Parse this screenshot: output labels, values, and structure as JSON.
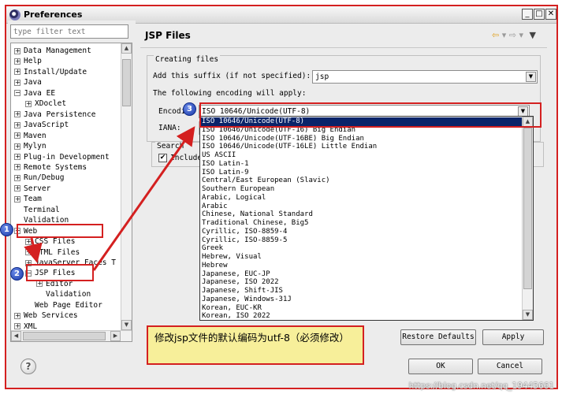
{
  "window": {
    "title": "Preferences",
    "minimize": "_",
    "maximize": "□",
    "close": "✕"
  },
  "sidebar": {
    "filter_placeholder": "type filter text",
    "tree": [
      {
        "label": "Data Management",
        "toggle": "+"
      },
      {
        "label": "Help",
        "toggle": "+"
      },
      {
        "label": "Install/Update",
        "toggle": "+"
      },
      {
        "label": "Java",
        "toggle": "+"
      },
      {
        "label": "Java EE",
        "toggle": "−"
      },
      {
        "label": "XDoclet",
        "toggle": "+"
      },
      {
        "label": "Java Persistence",
        "toggle": "+"
      },
      {
        "label": "JavaScript",
        "toggle": "+"
      },
      {
        "label": "Maven",
        "toggle": "+"
      },
      {
        "label": "Mylyn",
        "toggle": "+"
      },
      {
        "label": "Plug-in Development",
        "toggle": "+"
      },
      {
        "label": "Remote Systems",
        "toggle": "+"
      },
      {
        "label": "Run/Debug",
        "toggle": "+"
      },
      {
        "label": "Server",
        "toggle": "+"
      },
      {
        "label": "Team",
        "toggle": "+"
      },
      {
        "label": "Terminal",
        "toggle": ""
      },
      {
        "label": "Validation",
        "toggle": ""
      },
      {
        "label": "Web",
        "toggle": "−"
      },
      {
        "label": "CSS Files",
        "toggle": "+"
      },
      {
        "label": "HTML Files",
        "toggle": "+"
      },
      {
        "label": "JavaServer Faces T",
        "toggle": "+"
      },
      {
        "label": "JSP Files",
        "toggle": "−"
      },
      {
        "label": "Editor",
        "toggle": "+"
      },
      {
        "label": "Validation",
        "toggle": ""
      },
      {
        "label": "Web Page Editor",
        "toggle": ""
      },
      {
        "label": "Web Services",
        "toggle": "+"
      },
      {
        "label": "XML",
        "toggle": "+"
      }
    ]
  },
  "content": {
    "title": "JSP Files",
    "nav": {
      "back": "⇦",
      "back_menu": "▾",
      "forward": "⇨",
      "forward_menu": "▾",
      "view_menu": "▼"
    },
    "creating_group": {
      "legend": "Creating files",
      "suffix_label": "Add this suffix (if not specified):",
      "suffix_value": "jsp",
      "encoding_note": "The following encoding will apply:",
      "encoding_label": "Encoding:",
      "encoding_value": "ISO 10646/Unicode(UTF-8)",
      "iana_label": "IANA:"
    },
    "search_group": {
      "legend": "Search",
      "include_label": "Include",
      "include_checked": "✔"
    },
    "encoding_options": [
      "ISO 10646/Unicode(UTF-8)",
      "ISO 10646/Unicode(UTF-16) Big Endian",
      "ISO 10646/Unicode(UTF-16BE) Big Endian",
      "ISO 10646/Unicode(UTF-16LE) Little Endian",
      "US ASCII",
      "ISO Latin-1",
      "ISO Latin-9",
      "Central/East European (Slavic)",
      "Southern European",
      "Arabic, Logical",
      "Arabic",
      "Chinese, National Standard",
      "Traditional Chinese, Big5",
      "Cyrillic, ISO-8859-4",
      "Cyrillic, ISO-8859-5",
      "Greek",
      "Hebrew, Visual",
      "Hebrew",
      "Japanese, EUC-JP",
      "Japanese, ISO 2022",
      "Japanese, Shift-JIS",
      "Japanese, Windows-31J",
      "Korean, EUC-KR",
      "Korean, ISO 2022"
    ],
    "selected_option_index": 0,
    "restore_defaults": "Restore Defaults",
    "apply": "Apply"
  },
  "footer": {
    "help": "?",
    "ok": "OK",
    "cancel": "Cancel"
  },
  "annotations": {
    "markers": [
      "1",
      "2",
      "3"
    ],
    "callout_text": "修改jsp文件的默认编码为utf-8（必须修改）",
    "highlight_color": "#d42020",
    "marker_color": "#1a3aa8",
    "callout_bg": "#f7ef9a"
  },
  "watermark": "https://blog.csdn.net/qq_19445661"
}
